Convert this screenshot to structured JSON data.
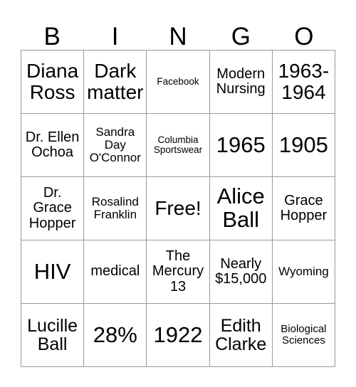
{
  "card": {
    "title": "BINGO",
    "free_space_label": "Free!",
    "header": [
      {
        "letter": "B"
      },
      {
        "letter": "I"
      },
      {
        "letter": "N"
      },
      {
        "letter": "G"
      },
      {
        "letter": "O"
      }
    ],
    "rows": [
      [
        {
          "text": "Diana Ross",
          "size": "xl"
        },
        {
          "text": "Dark matter",
          "size": "xl"
        },
        {
          "text": "Facebook",
          "size": "xxs"
        },
        {
          "text": "Modern Nursing",
          "size": "md"
        },
        {
          "text": "1963-\n1964",
          "size": "xl"
        }
      ],
      [
        {
          "text": "Dr. Ellen Ochoa",
          "size": "md"
        },
        {
          "text": "Sandra Day O'Connor",
          "size": "sm"
        },
        {
          "text": "Columbia Sportswear",
          "size": "xxs"
        },
        {
          "text": "1965",
          "size": "xxl"
        },
        {
          "text": "1905",
          "size": "xxl"
        }
      ],
      [
        {
          "text": "Dr. Grace Hopper",
          "size": "md"
        },
        {
          "text": "Rosalind Franklin",
          "size": "sm"
        },
        {
          "text": "Free!",
          "size": "xl"
        },
        {
          "text": "Alice Ball",
          "size": "xxl"
        },
        {
          "text": "Grace Hopper",
          "size": "md"
        }
      ],
      [
        {
          "text": "HIV",
          "size": "xxl"
        },
        {
          "text": "medical",
          "size": "md"
        },
        {
          "text": "The Mercury 13",
          "size": "md"
        },
        {
          "text": "Nearly $15,000",
          "size": "md"
        },
        {
          "text": "Wyoming",
          "size": "sm"
        }
      ],
      [
        {
          "text": "Lucille Ball",
          "size": "lg"
        },
        {
          "text": "28%",
          "size": "xxl"
        },
        {
          "text": "1922",
          "size": "xxl"
        },
        {
          "text": "Edith Clarke",
          "size": "lg"
        },
        {
          "text": "Biological Sciences",
          "size": "xs"
        }
      ]
    ]
  },
  "colors": {
    "background": "#ffffff",
    "text": "#000000",
    "grid_line": "#9a9a9a"
  }
}
